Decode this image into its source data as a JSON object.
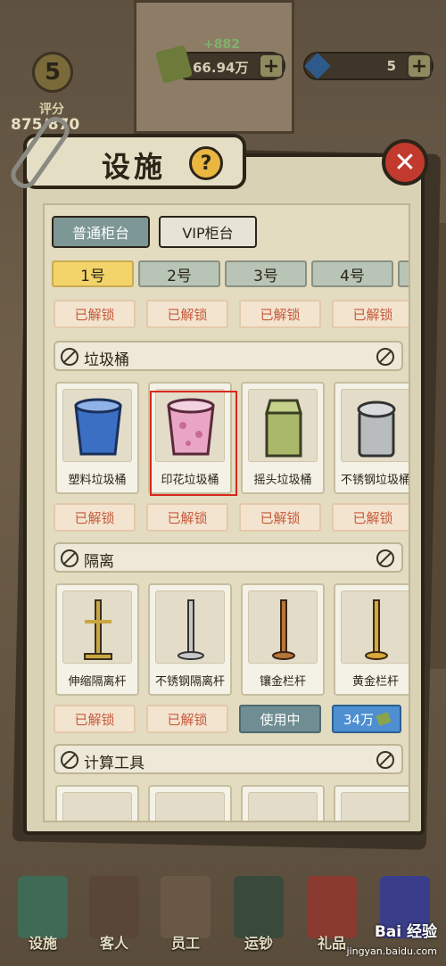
{
  "hud": {
    "level": "5",
    "rating_label": "评分",
    "rating_value": "875/870",
    "money_gain": "+882",
    "money": "66.94万",
    "gems": "5",
    "plus": "+"
  },
  "panel": {
    "title": "设施",
    "help": "?",
    "close": "✕",
    "type_tabs": [
      "普通柜台",
      "VIP柜台"
    ],
    "counter_tabs": [
      "1号",
      "2号",
      "3号",
      "4号"
    ],
    "top_row_status": [
      "已解锁",
      "已解锁",
      "已解锁",
      "已解锁"
    ],
    "sections": [
      {
        "name": "垃圾桶",
        "items": [
          "塑料垃圾桶",
          "印花垃圾桶",
          "摇头垃圾桶",
          "不锈钢垃圾桶"
        ],
        "status": [
          "已解锁",
          "已解锁",
          "已解锁",
          "已解锁"
        ]
      },
      {
        "name": "隔离",
        "items": [
          "伸缩隔离杆",
          "不锈钢隔离杆",
          "镶金栏杆",
          "黄金栏杆"
        ],
        "status": [
          "已解锁",
          "已解锁",
          "使用中",
          "34万"
        ]
      },
      {
        "name": "计算工具",
        "items": [],
        "status": []
      }
    ]
  },
  "nav": [
    "设施",
    "客人",
    "员工",
    "运钞",
    "礼品"
  ],
  "watermark": {
    "main": "Bai 经验",
    "sub": "jingyan.baidu.com"
  },
  "colors": {
    "highlight": "#d8281e",
    "unlock_text": "#c55a3b",
    "in_use_bg": "#6f8d92",
    "price_bg": "#4d8fd1",
    "active_tab": "#f2d46a"
  }
}
